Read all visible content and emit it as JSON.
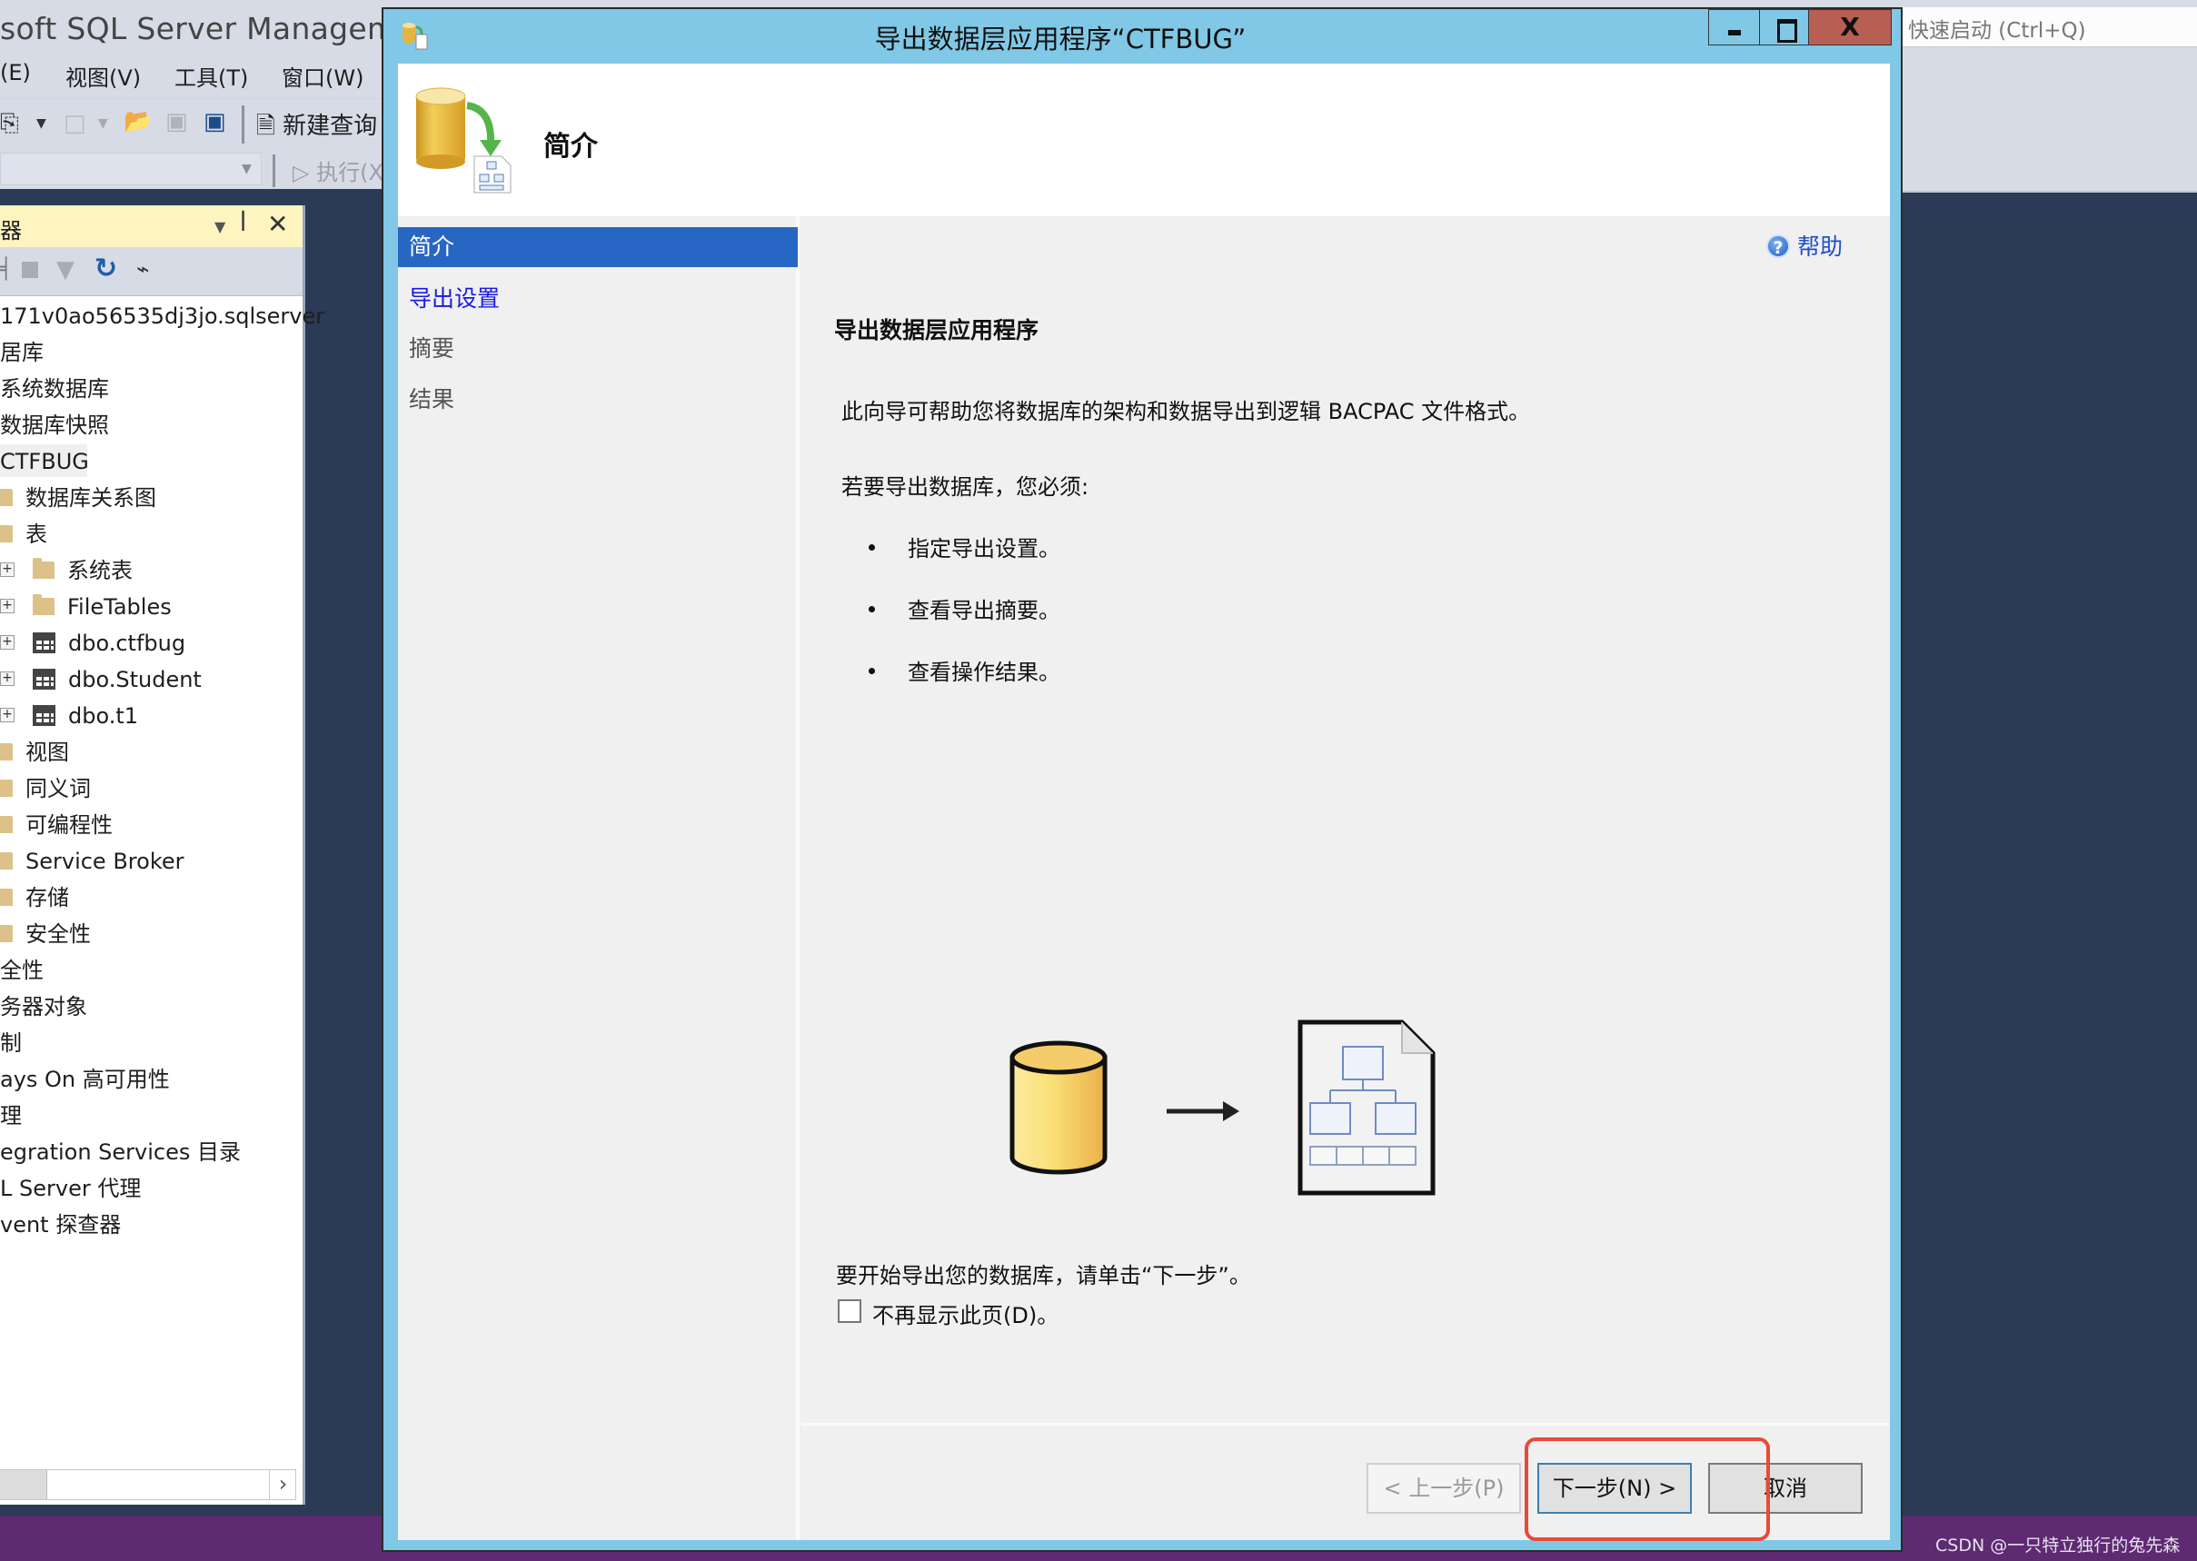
{
  "app": {
    "title": "soft SQL Server Management",
    "menu": [
      "(E)",
      "视图(V)",
      "工具(T)",
      "窗口(W)"
    ],
    "toolbar": {
      "new_query": "新建查询",
      "execute": "执行(X"
    },
    "quick_launch_placeholder": "快速启动 (Ctrl+Q)"
  },
  "object_explorer": {
    "title": "器",
    "tree": [
      {
        "label": "171v0ao56535dj3jo.sqlserver",
        "indent": 0,
        "icon": "none"
      },
      {
        "label": "居库",
        "indent": 0,
        "icon": "none"
      },
      {
        "label": "系统数据库",
        "indent": 0,
        "icon": "none"
      },
      {
        "label": "数据库快照",
        "indent": 0,
        "icon": "none"
      },
      {
        "label": "CTFBUG",
        "indent": 0,
        "icon": "none",
        "selected": true
      },
      {
        "label": "数据库关系图",
        "indent": 1,
        "icon": "folder-icon"
      },
      {
        "label": "表",
        "indent": 1,
        "icon": "folder-icon"
      },
      {
        "label": "系统表",
        "indent": 2,
        "icon": "folder-icon",
        "expander": "+"
      },
      {
        "label": "FileTables",
        "indent": 2,
        "icon": "folder-icon",
        "expander": "+"
      },
      {
        "label": "dbo.ctfbug",
        "indent": 2,
        "icon": "table-icon",
        "expander": "+"
      },
      {
        "label": "dbo.Student",
        "indent": 2,
        "icon": "table-icon",
        "expander": "+"
      },
      {
        "label": "dbo.t1",
        "indent": 2,
        "icon": "table-icon",
        "expander": "+"
      },
      {
        "label": "视图",
        "indent": 1,
        "icon": "folder-icon"
      },
      {
        "label": "同义词",
        "indent": 1,
        "icon": "folder-icon"
      },
      {
        "label": "可编程性",
        "indent": 1,
        "icon": "folder-icon"
      },
      {
        "label": "Service Broker",
        "indent": 1,
        "icon": "folder-icon"
      },
      {
        "label": "存储",
        "indent": 1,
        "icon": "folder-icon"
      },
      {
        "label": "安全性",
        "indent": 1,
        "icon": "folder-icon"
      },
      {
        "label": "全性",
        "indent": 0,
        "icon": "none"
      },
      {
        "label": "务器对象",
        "indent": 0,
        "icon": "none"
      },
      {
        "label": "制",
        "indent": 0,
        "icon": "none"
      },
      {
        "label": "ays On 高可用性",
        "indent": 0,
        "icon": "none"
      },
      {
        "label": "理",
        "indent": 0,
        "icon": "none"
      },
      {
        "label": "egration Services 目录",
        "indent": 0,
        "icon": "none"
      },
      {
        "label": "L Server 代理",
        "indent": 0,
        "icon": "none"
      },
      {
        "label": "vent 探查器",
        "indent": 0,
        "icon": "none"
      }
    ]
  },
  "dialog": {
    "title": "导出数据层应用程序“CTFBUG”",
    "header_title": "简介",
    "nav": [
      {
        "label": "简介",
        "state": "active"
      },
      {
        "label": "导出设置",
        "state": "link"
      },
      {
        "label": "摘要",
        "state": "muted"
      },
      {
        "label": "结果",
        "state": "muted"
      }
    ],
    "help_label": "帮助",
    "content": {
      "heading": "导出数据层应用程序",
      "description": "此向导可帮助您将数据库的架构和数据导出到逻辑 BACPAC 文件格式。",
      "must_intro": "若要导出数据库，您必须:",
      "steps": [
        "指定导出设置。",
        "查看导出摘要。",
        "查看操作结果。"
      ],
      "start_text": "要开始导出您的数据库，请单击“下一步”。",
      "dont_show_label": "不再显示此页(D)。",
      "dont_show_checked": false
    },
    "buttons": {
      "back": "< 上一步(P)",
      "next": "下一步(N) >",
      "cancel": "取消"
    },
    "colors": {
      "title_bar": "#80c8e6",
      "nav_active": "#2866c4",
      "close_button": "#b85f53",
      "highlight_annotation": "#e84a35"
    }
  },
  "watermark": "CSDN @一只特立独行的兔先森"
}
